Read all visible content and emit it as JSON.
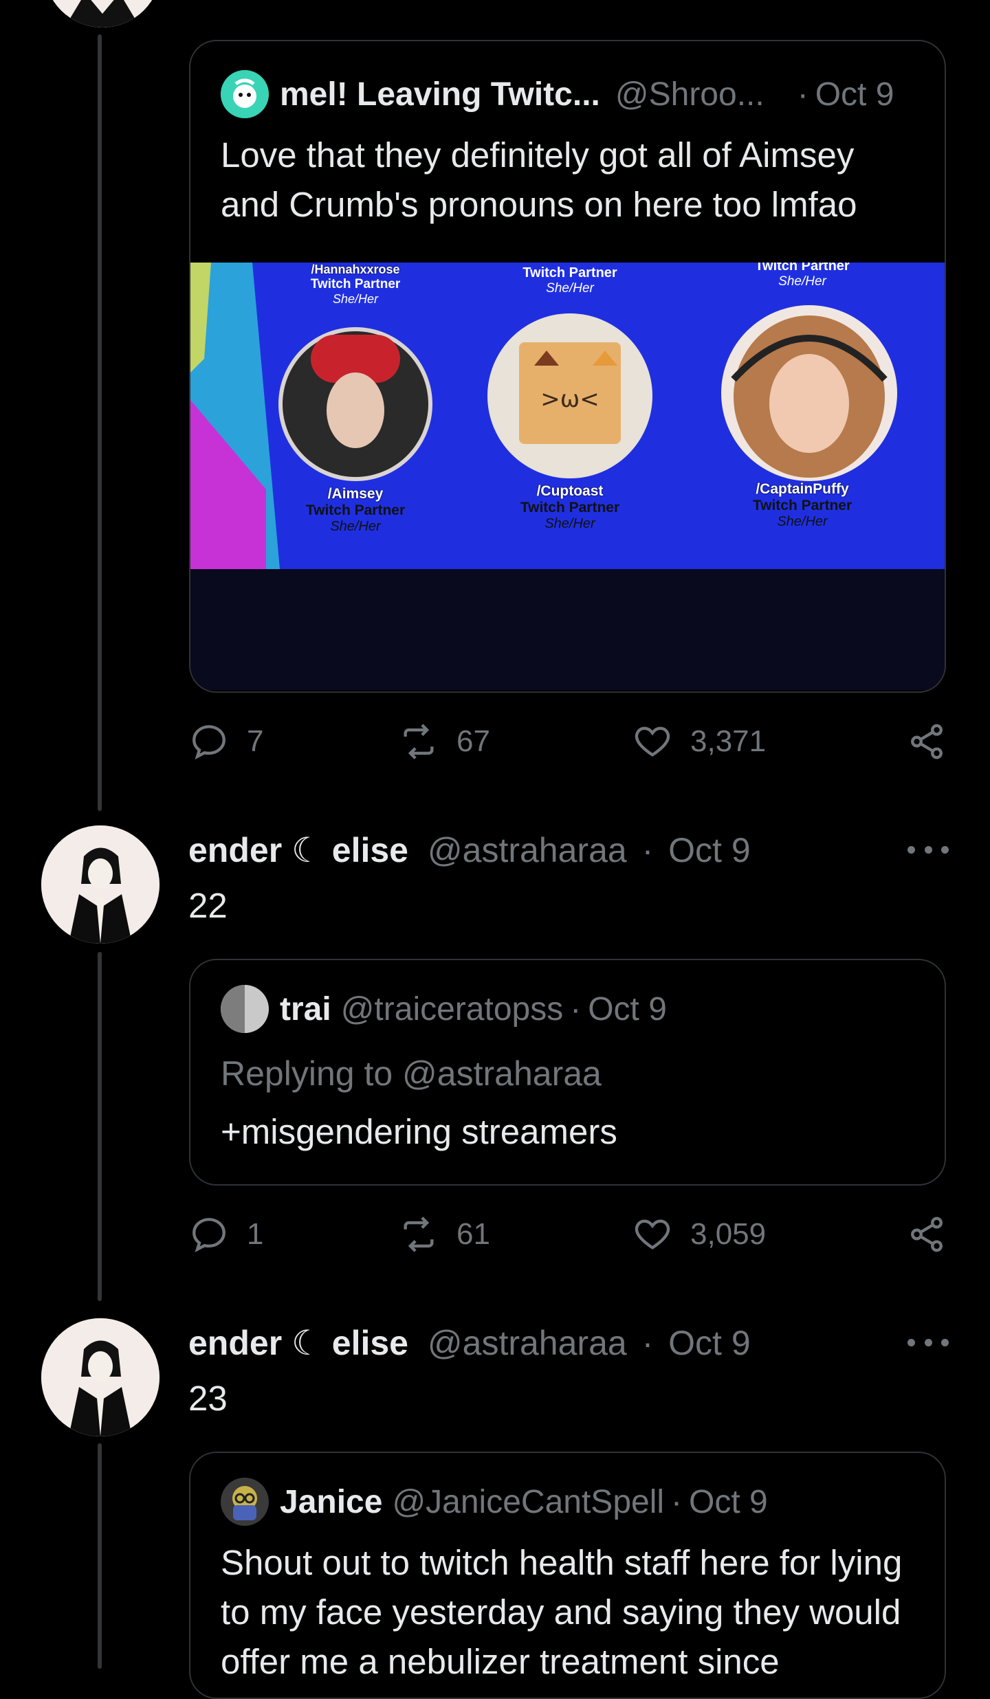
{
  "colors": {
    "background": "#000000",
    "text_primary": "#e7e9ea",
    "text_secondary": "#71767b",
    "border": "#2f3336",
    "media_blue": "#1f2fe0"
  },
  "quote1": {
    "name": "mel! Leaving Twitc...",
    "handle": "@Shroo...",
    "sep": "·",
    "time": "Oct 9",
    "text": "Love that they definitely got all of Aimsey and Crumb's pronouns on here too lmfao",
    "media": {
      "top_left_name": "/Hannahxxrose",
      "top_left_role": "Twitch Partner",
      "top_left_pron": "She/Her",
      "top_mid_role": "Twitch Partner",
      "top_mid_pron": "She/Her",
      "top_right_role": "Twitch Partner",
      "top_right_pron": "She/Her",
      "p1_name": "/Aimsey",
      "p1_role": "Twitch Partner",
      "p1_pron": "She/Her",
      "p2_name": "/Cuptoast",
      "p2_role": "Twitch Partner",
      "p2_pron": "She/Her",
      "p3_name": "/CaptainPuffy",
      "p3_role": "Twitch Partner",
      "p3_pron": "She/Her"
    }
  },
  "actions1": {
    "replies": "7",
    "retweets": "67",
    "likes": "3,371"
  },
  "tweet2": {
    "name": "ender ☾ elise",
    "handle": "@astraharaa",
    "sep": "·",
    "time": "Oct 9",
    "text": "22"
  },
  "quote2": {
    "name": "trai",
    "handle": "@traiceratopss",
    "sep": "·",
    "time": "Oct 9",
    "replying": "Replying to @astraharaa",
    "text": "+misgendering streamers"
  },
  "actions2": {
    "replies": "1",
    "retweets": "61",
    "likes": "3,059"
  },
  "tweet3": {
    "name": "ender ☾ elise",
    "handle": "@astraharaa",
    "sep": "·",
    "time": "Oct 9",
    "text": "23"
  },
  "quote3": {
    "name": "Janice",
    "handle": "@JaniceCantSpell",
    "sep": "·",
    "time": "Oct 9",
    "text": "Shout out to twitch health staff here for lying to my face yesterday and saying they would offer me a nebulizer treatment since"
  },
  "icons": {
    "reply": "reply-icon",
    "retweet": "retweet-icon",
    "like": "heart-icon",
    "share": "share-icon",
    "more": "more-icon"
  }
}
